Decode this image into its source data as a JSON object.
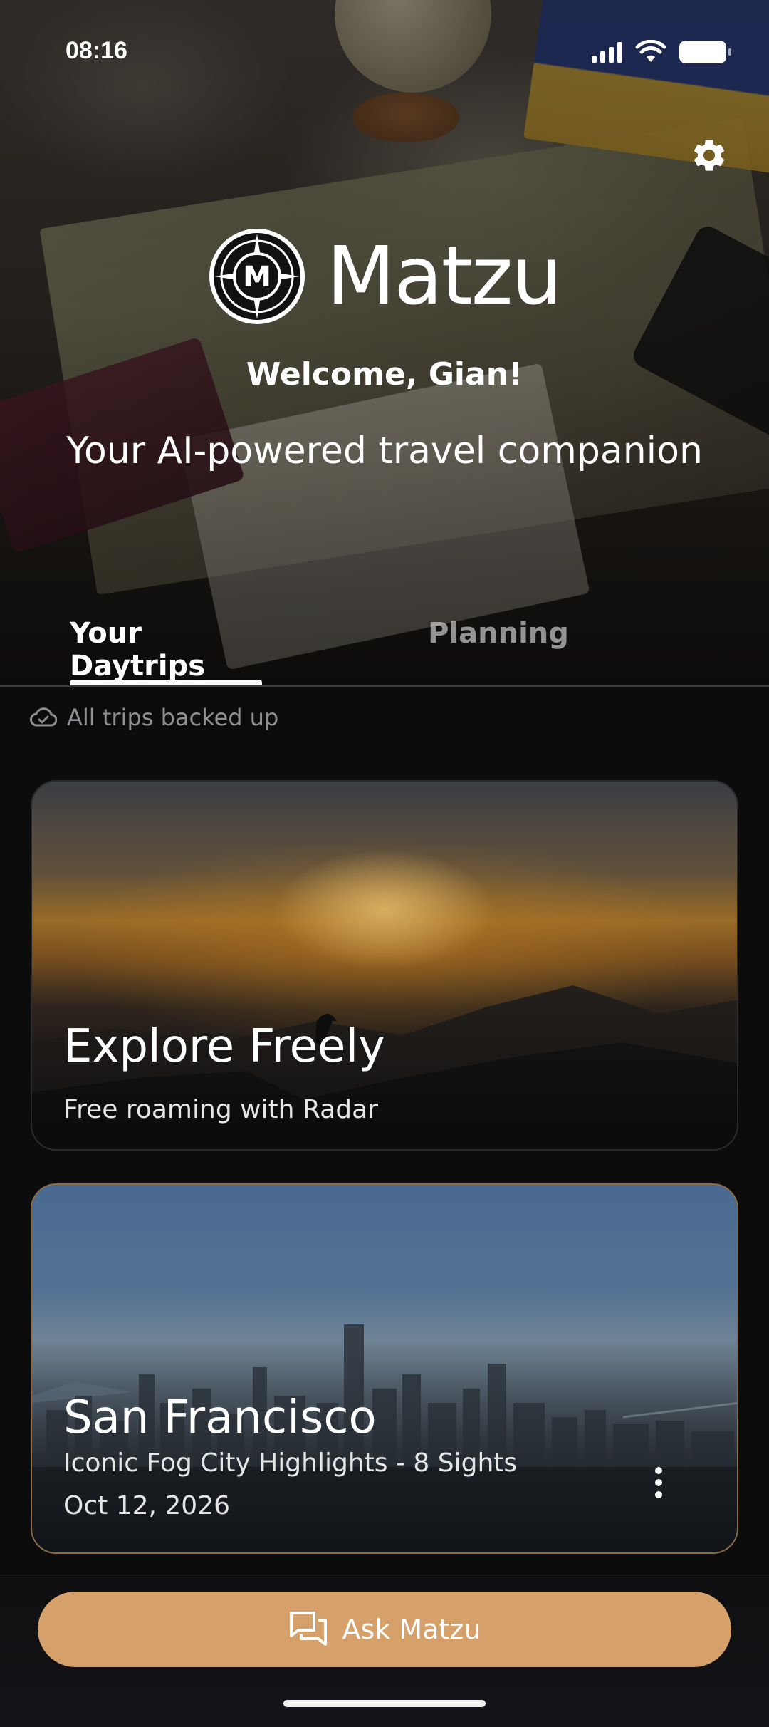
{
  "status_bar": {
    "time": "08:16"
  },
  "header": {
    "app_name": "Matzu",
    "logo_letter": "M",
    "welcome": "Welcome, Gian!",
    "tagline": "Your AI-powered travel companion"
  },
  "tabs": [
    {
      "label": "Your Daytrips",
      "selected": true
    },
    {
      "label": "Planning",
      "selected": false
    }
  ],
  "backup_status": "All trips backed up",
  "cards": [
    {
      "title": "Explore Freely",
      "subtitle": "Free roaming with Radar"
    },
    {
      "title": "San Francisco",
      "subtitle": "Iconic Fog City Highlights - 8 Sights",
      "date": "Oct 12, 2026"
    }
  ],
  "ask_button": {
    "label": "Ask Matzu",
    "color": "#d6a06a"
  },
  "icons": {
    "settings": "gear-icon",
    "cloud": "cloud-check-icon",
    "chat": "chat-bubbles-icon",
    "more": "more-vertical-icon"
  }
}
